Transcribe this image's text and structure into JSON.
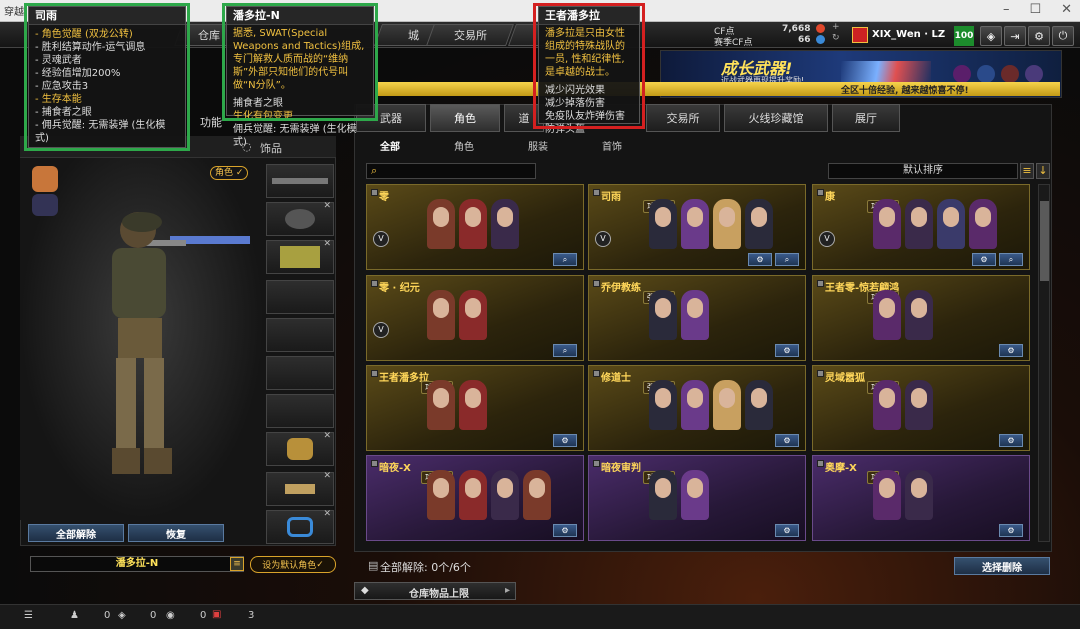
{
  "window": {
    "title": "穿越"
  },
  "nav": {
    "tabs": [
      "仓库",
      "城",
      "交易所"
    ]
  },
  "currency": {
    "cf_label": "CF点",
    "cf_value": "7,668",
    "comp_label": "赛季CF点",
    "comp_value": "66"
  },
  "user": {
    "name": "XIX_Wen · LZ",
    "level": "100"
  },
  "banner": {
    "title": "成长武器!",
    "subtitle": "近战武器再现提升奖励!",
    "gold_text": "全区十倍经验, 越来越惊喜不停!"
  },
  "left": {
    "tabs": [
      "功能",
      "饰品"
    ],
    "role_badge": "角色",
    "unequip_all": "全部解除",
    "restore": "恢复",
    "character_name": "潘多拉-N",
    "set_default": "设为默认角色"
  },
  "right": {
    "tabs": [
      "武器",
      "角色",
      "道",
      "交易所",
      "火线珍藏馆",
      "展厅"
    ],
    "subtabs": [
      "全部",
      "角色",
      "服装",
      "首饰"
    ],
    "sort_label": "默认排序",
    "cards": [
      {
        "name": "零",
        "tag": ""
      },
      {
        "name": "司雨",
        "tag": "功能型"
      },
      {
        "name": "康",
        "tag": "功能型"
      },
      {
        "name": "零 · 纪元",
        "tag": ""
      },
      {
        "name": "乔伊教练",
        "tag": "强化型"
      },
      {
        "name": "王者零-惊若翩鸿",
        "tag": "功能型"
      },
      {
        "name": "王者潘多拉",
        "tag": "功能型"
      },
      {
        "name": "修道士",
        "tag": "强化型"
      },
      {
        "name": "灵域嚣狐",
        "tag": "功能型"
      },
      {
        "name": "暗夜-X",
        "tag": "功能型"
      },
      {
        "name": "暗夜审判",
        "tag": "功能型"
      },
      {
        "name": "奥摩-X",
        "tag": "功能型"
      }
    ],
    "unequip_text": "全部解除: 0个/6个",
    "warehouse_limit": "仓库物品上限",
    "select_delete": "选择删除"
  },
  "status": {
    "v1": "0",
    "v2": "0",
    "v3": "0",
    "v4": "3"
  },
  "tooltips": {
    "siyu": {
      "title": "司雨",
      "lines": [
        "- 角色觉醒 (双龙公转)",
        "- 胜利结算动作-运气调息",
        "- 灵魂武者",
        "- 经验值增加200%",
        "- 应急攻击3",
        "- 生存本能",
        "- 捕食者之眼",
        "- 佣兵觉醒: 无需装弹 (生化模式)"
      ]
    },
    "pandora": {
      "title": "潘多拉-N",
      "desc": "据悉, SWAT(Special Weapons and Tactics)组成, 专门解救人质而战的“维纳斯”外部只知他们的代号叫做“N分队”。",
      "lines": [
        "捕食者之眼",
        "生化有包变更",
        "佣兵觉醒: 无需装弹 (生化模式)"
      ]
    },
    "wangzhe": {
      "title": "王者潘多拉",
      "desc": "潘多拉是只由女性组成的特殊战队的一员, 性和纪律性, 是卓越的战士。",
      "lines": [
        "减少闪光效果",
        "减少掉落伤害",
        "免疫队友炸弹伤害",
        "防弹头盔"
      ]
    }
  }
}
